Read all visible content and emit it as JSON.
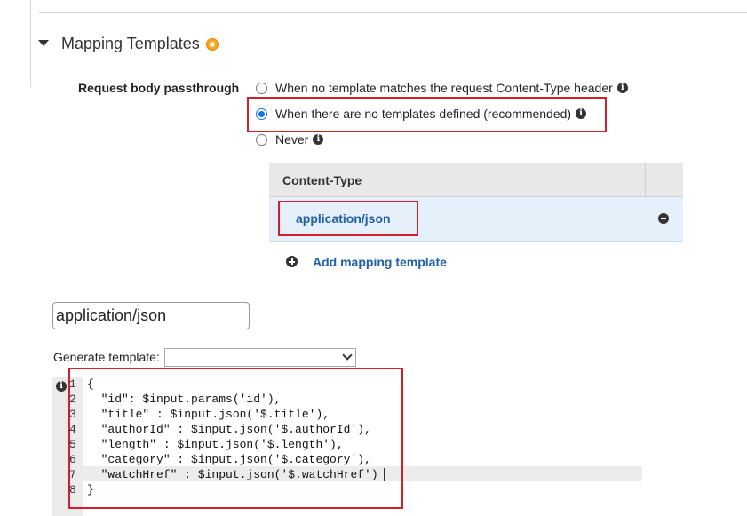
{
  "section": {
    "title": "Mapping Templates"
  },
  "passthrough": {
    "label": "Request body passthrough",
    "options": [
      {
        "label": "When no template matches the request Content-Type header",
        "checked": false
      },
      {
        "label": "When there are no templates defined (recommended)",
        "checked": true
      },
      {
        "label": "Never",
        "checked": false
      }
    ]
  },
  "content_type_table": {
    "header": "Content-Type",
    "rows": [
      {
        "value": "application/json"
      }
    ],
    "add_label": "Add mapping template"
  },
  "content_type_input": {
    "value": "application/json"
  },
  "generate_template": {
    "label": "Generate template:",
    "selected": ""
  },
  "editor": {
    "line_numbers": [
      "1",
      "2",
      "3",
      "4",
      "5",
      "6",
      "7",
      "8"
    ],
    "lines": [
      "{",
      "  \"id\": $input.params('id'),",
      "  \"title\" : $input.json('$.title'),",
      "  \"authorId\" : $input.json('$.authorId'),",
      "  \"length\" : $input.json('$.length'),",
      "  \"category\" : $input.json('$.category'),",
      "  \"watchHref\" : $input.json('$.watchHref')",
      "}"
    ]
  },
  "colors": {
    "highlight_border": "#d0202e",
    "link": "#1f5fa8",
    "radio_checked": "#1a73e8",
    "selected_row": "#e5f0fb"
  }
}
